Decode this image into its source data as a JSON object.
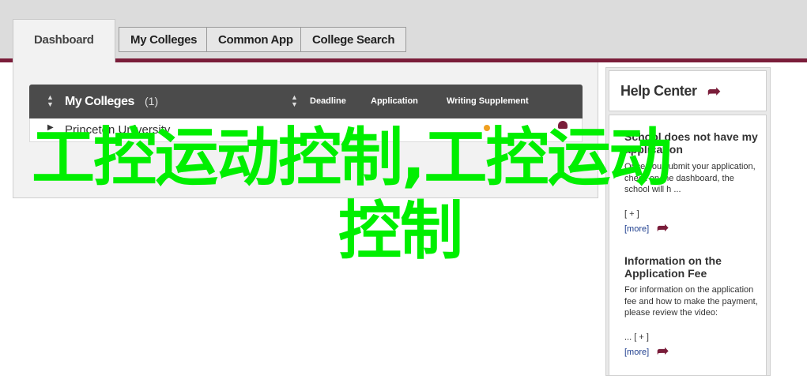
{
  "tabs": [
    {
      "label": "Dashboard",
      "active": true
    },
    {
      "label": "My Colleges"
    },
    {
      "label": "Common App"
    },
    {
      "label": "College Search"
    }
  ],
  "my_colleges": {
    "title": "My Colleges",
    "count": "(1)",
    "columns": [
      "Deadline",
      "Application",
      "Writing Supplement"
    ],
    "rows": [
      {
        "name": "Princeton University"
      }
    ]
  },
  "help_center": {
    "title": "Help Center",
    "articles": [
      {
        "title": "School does not have my application",
        "text": "Once you submit your application, check on the dashboard, the school will h ...",
        "toggle": "[ + ]",
        "more": "[more]"
      },
      {
        "title": "Information on the Application Fee",
        "text": "For information on the application fee and how to make the payment, please review the video:",
        "toggle": "... [ + ]",
        "more": "[more]"
      }
    ]
  },
  "overlay": {
    "line1": "工控运动控制,工控运动",
    "line2": "控制"
  },
  "colors": {
    "accent": "#7a1d3a",
    "overlay_green": "#00ef00",
    "table_header": "#4b4b4b"
  }
}
